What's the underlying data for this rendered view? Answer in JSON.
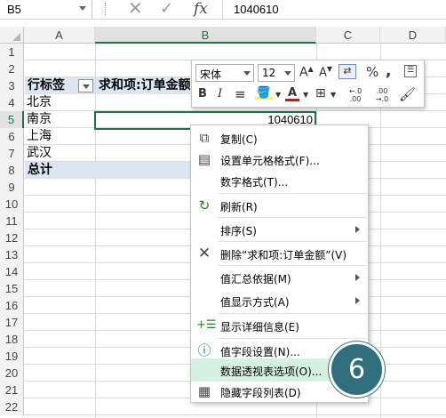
{
  "formula_bar": {
    "name_box": "B5",
    "cancel_icon": "close-icon",
    "enter_icon": "check-icon",
    "fx_label": "fx",
    "value": "1040610"
  },
  "columns": [
    "A",
    "B",
    "C",
    "D"
  ],
  "rows": [
    "1",
    "2",
    "3",
    "4",
    "5",
    "6",
    "7",
    "8",
    "9",
    "10",
    "11",
    "12",
    "13",
    "14",
    "15",
    "16",
    "17",
    "18",
    "19",
    "20",
    "21",
    "22"
  ],
  "pivot": {
    "row_label_header": "行标签",
    "value_header": "求和项:订单金额",
    "items": [
      "北京",
      "南京",
      "上海",
      "武汉"
    ],
    "total_label": "总计",
    "selected_value": "1040610"
  },
  "mini_toolbar": {
    "font_name": "宋体",
    "font_size": "12",
    "grow_font": "A",
    "shrink_font": "A",
    "percent": "%",
    "comma": ",",
    "bold": "B",
    "italic": "I",
    "align": "≡",
    "font_color_letter": "A",
    "inc_decimal": "←.0 .00",
    "dec_decimal": ".00 →.0",
    "accent_color": "#ff0000",
    "highlight_color": "#ffff00"
  },
  "context_menu": {
    "items": [
      {
        "label": "复制(C)",
        "icon": "copy-icon"
      },
      {
        "label": "设置单元格格式(F)...",
        "icon": "format-cells-icon"
      },
      {
        "label": "数字格式(T)...",
        "icon": ""
      },
      {
        "label": "刷新(R)",
        "icon": "refresh-icon"
      },
      {
        "label": "排序(S)",
        "icon": "",
        "submenu": true
      },
      {
        "label": "删除“求和项:订单金额”(V)",
        "icon": "delete-x-icon"
      },
      {
        "label": "值汇总依据(M)",
        "icon": "",
        "submenu": true
      },
      {
        "label": "值显示方式(A)",
        "icon": "",
        "submenu": true
      },
      {
        "label": "显示详细信息(E)",
        "icon": "show-details-icon"
      },
      {
        "label": "值字段设置(N)...",
        "icon": "field-settings-icon"
      },
      {
        "label": "数据透视表选项(O)...",
        "icon": ""
      },
      {
        "label": "隐藏字段列表(D)",
        "icon": "field-list-icon"
      }
    ]
  },
  "step_badge": "6",
  "colors": {
    "accent": "#217346",
    "highlight": "#d3f0e0",
    "badge": "#2f6f7e",
    "pivot_header": "#dce6f1"
  }
}
